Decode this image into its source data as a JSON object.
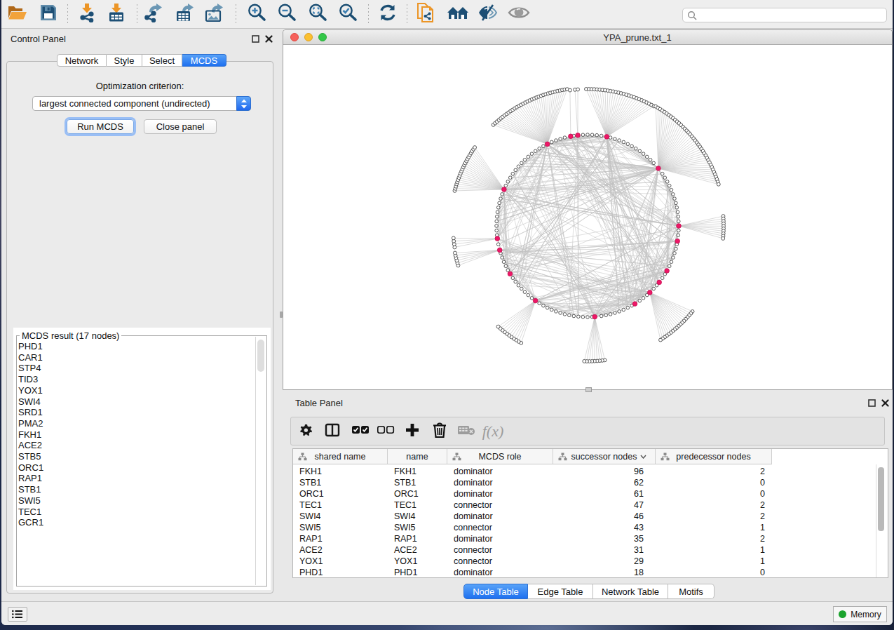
{
  "toolbar": {
    "icons": [
      "open-file",
      "save-session",
      "import-network",
      "import-table",
      "export-network",
      "export-table",
      "export-image",
      "zoom-in",
      "zoom-out",
      "zoom-fit",
      "zoom-selected",
      "refresh",
      "clone-network",
      "home-gallery",
      "hide-graphics-details",
      "show-graphics-details"
    ],
    "search": {
      "placeholder": "",
      "value": ""
    }
  },
  "control_panel": {
    "title": "Control Panel",
    "tabs": [
      {
        "label": "Network",
        "selected": false
      },
      {
        "label": "Style",
        "selected": false
      },
      {
        "label": "Select",
        "selected": false
      },
      {
        "label": "MCDS",
        "selected": true
      }
    ],
    "optimization_label": "Optimization criterion:",
    "criterion_value": "largest connected component (undirected)",
    "run_button": "Run MCDS",
    "close_button": "Close panel",
    "result_title": "MCDS result (17 nodes)",
    "result_nodes": [
      "PHD1",
      "CAR1",
      "STP4",
      "TID3",
      "YOX1",
      "SWI4",
      "SRD1",
      "PMA2",
      "FKH1",
      "ACE2",
      "STB5",
      "ORC1",
      "RAP1",
      "STB1",
      "SWI5",
      "TEC1",
      "GCR1"
    ]
  },
  "network_window": {
    "title": "YPA_prune.txt_1"
  },
  "table_panel": {
    "title": "Table Panel",
    "tools": [
      "column-settings",
      "split-panel",
      "select-all",
      "deselect-all",
      "add-column",
      "delete-column",
      "delete-table",
      "function-builder"
    ],
    "columns": [
      {
        "label": "shared name",
        "width": 135,
        "icon": true,
        "chevron": false,
        "align": "left"
      },
      {
        "label": "name",
        "width": 85,
        "icon": false,
        "chevron": false,
        "align": "left"
      },
      {
        "label": "MCDS role",
        "width": 151,
        "icon": true,
        "chevron": false,
        "align": "left"
      },
      {
        "label": "successor nodes",
        "width": 146,
        "icon": true,
        "chevron": true,
        "align": "right",
        "pad": 17
      },
      {
        "label": "predecessor nodes",
        "width": 166,
        "icon": true,
        "chevron": false,
        "align": "right",
        "pad": 10
      }
    ],
    "rows": [
      [
        "FKH1",
        "FKH1",
        "dominator",
        "96",
        "2"
      ],
      [
        "STB1",
        "STB1",
        "dominator",
        "62",
        "0"
      ],
      [
        "ORC1",
        "ORC1",
        "dominator",
        "61",
        "0"
      ],
      [
        "TEC1",
        "TEC1",
        "connector",
        "47",
        "2"
      ],
      [
        "SWI4",
        "SWI4",
        "dominator",
        "46",
        "2"
      ],
      [
        "SWI5",
        "SWI5",
        "connector",
        "43",
        "1"
      ],
      [
        "RAP1",
        "RAP1",
        "dominator",
        "35",
        "2"
      ],
      [
        "ACE2",
        "ACE2",
        "connector",
        "31",
        "1"
      ],
      [
        "YOX1",
        "YOX1",
        "connector",
        "29",
        "1"
      ],
      [
        "PHD1",
        "PHD1",
        "dominator",
        "18",
        "0"
      ]
    ],
    "tabs": [
      {
        "label": "Node Table",
        "selected": true,
        "width": 92
      },
      {
        "label": "Edge Table",
        "selected": false,
        "width": 93
      },
      {
        "label": "Network Table",
        "selected": false,
        "width": 107
      },
      {
        "label": "Motifs",
        "selected": false,
        "width": 66
      }
    ]
  },
  "status_bar": {
    "memory_label": "Memory"
  },
  "chart_data": {
    "type": "network-circular-layout",
    "description": "Yeast transcription network YPA_prune.txt_1 in circular layout; pink nodes are the 17 MCDS dominating-set hubs on the main ring, white leaf nodes fan out in outer arcs",
    "center": [
      434,
      258
    ],
    "ring_radius": 130,
    "ring_count": 124,
    "node_radius": 2.3,
    "hub_radius": 3.3,
    "leaf_radius": 2.45,
    "colors": {
      "hub": "#ee1767",
      "hub_stroke": "#c51253",
      "node_fill": "#ffffff",
      "node_stroke": "#3c3c3c",
      "edge": "#c2c2c2"
    },
    "seed": 12,
    "hubs": [
      {
        "angle": -116.2,
        "chords": 50
      },
      {
        "angle": -100.7,
        "chords": 14
      },
      {
        "angle": -96.2,
        "chords": 14
      },
      {
        "angle": -77.9,
        "chords": 41
      },
      {
        "angle": -39.1,
        "chords": 76
      },
      {
        "angle": -156.4,
        "chords": 35
      },
      {
        "angle": 0,
        "chords": 24
      },
      {
        "angle": 9.6,
        "chords": 11
      },
      {
        "angle": 172,
        "chords": 15
      },
      {
        "angle": 164.6,
        "chords": 15
      },
      {
        "angle": 148.3,
        "chords": 21
      },
      {
        "angle": 29.5,
        "chords": 18
      },
      {
        "angle": 38.2,
        "chords": 15
      },
      {
        "angle": 46.9,
        "chords": 30
      },
      {
        "angle": 58.7,
        "chords": 15
      },
      {
        "angle": 124.9,
        "chords": 26
      },
      {
        "angle": 85.5,
        "chords": 24
      }
    ],
    "fans": [
      {
        "hub": -116.2,
        "a0": -133.0,
        "a1": -98.5,
        "r": 197,
        "n": 35
      },
      {
        "hub": -100.7,
        "a0": -97.4,
        "a1": -97.4,
        "r": 195,
        "n": 1
      },
      {
        "hub": -96.2,
        "a0": -95.3,
        "a1": -94.1,
        "r": 195,
        "n": 2
      },
      {
        "hub": -77.9,
        "a0": -90.6,
        "a1": -61.0,
        "r": 195,
        "n": 27
      },
      {
        "hub": -39.1,
        "a0": -60.3,
        "a1": -17.6,
        "r": 196,
        "n": 40
      },
      {
        "hub": -156.4,
        "a0": 194.8,
        "a1": 214.8,
        "r": 196,
        "n": 22
      },
      {
        "hub": 172,
        "a0": 170.9,
        "a1": 174.8,
        "r": 192,
        "n": 4
      },
      {
        "hub": 164.6,
        "a0": 163.0,
        "a1": 168.5,
        "r": 193,
        "n": 6
      },
      {
        "hub": 124.9,
        "a0": 119.6,
        "a1": 131.6,
        "r": 192,
        "n": 11
      },
      {
        "hub": 85.5,
        "a0": 82.7,
        "a1": 91.4,
        "r": 193,
        "n": 9
      },
      {
        "hub": 46.9,
        "a0": 39.2,
        "a1": 57.4,
        "r": 193,
        "n": 18
      },
      {
        "hub": 0,
        "a0": -4.1,
        "a1": 5.3,
        "r": 194,
        "n": 10
      }
    ],
    "hub_links": 18
  }
}
